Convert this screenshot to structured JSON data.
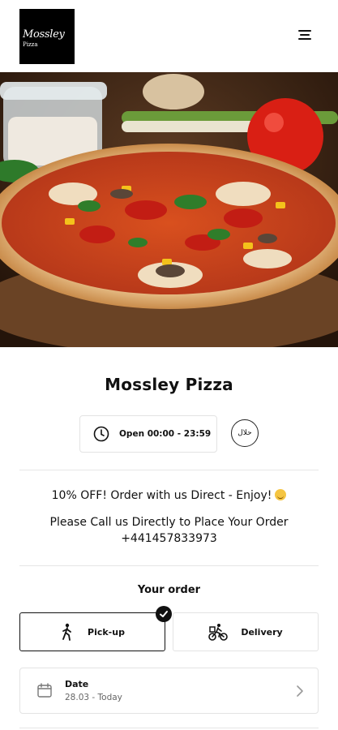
{
  "header": {
    "logo_line1": "Mossley",
    "logo_line2": "Pizza",
    "menu_icon": "hamburger-menu-icon"
  },
  "hero": {
    "image": "pizza-hero-photo"
  },
  "restaurant": {
    "name": "Mossley Pizza",
    "hours": "Open 00:00 - 23:59",
    "clock_icon": "clock-icon",
    "halal_icon": "halal-badge-icon",
    "halal_text": "حلال"
  },
  "promo": {
    "line1": "10% OFF! Order with us Direct - Enjoy!",
    "line2": "Please Call us Directly to Place Your Order",
    "phone": "+441457833973"
  },
  "order": {
    "title": "Your order",
    "options": [
      {
        "label": "Pick-up",
        "icon": "walking-person-icon",
        "selected": true
      },
      {
        "label": "Delivery",
        "icon": "bicycle-courier-icon",
        "selected": false
      }
    ],
    "date_label": "Date",
    "date_value": "28.03 - Today"
  },
  "colors": {
    "primary": "#111111",
    "border": "#e3e3e3",
    "muted": "#666666"
  }
}
